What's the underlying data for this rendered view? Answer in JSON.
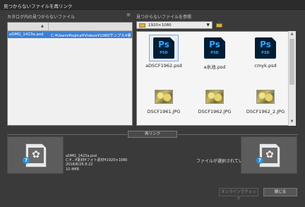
{
  "window": {
    "title": "見つからないファイルを再リンク"
  },
  "left": {
    "caption": "カタログ内の見つからないファイル",
    "menu_icon": "list-menu-icon",
    "columns": {
      "name": "ファイル名",
      "location": "元の場所"
    },
    "rows": [
      {
        "name": "aDMG_1423a.psd",
        "location": "C:¥Users¥tojma¥Videos¥1080サンプル¥素材¥..."
      }
    ]
  },
  "right": {
    "caption": "見つからないファイルを参照",
    "folder_value": "1920×1080",
    "tiles": [
      {
        "name": "aDSCF1962.psd",
        "kind": "psd",
        "selected": true
      },
      {
        "name": "a氷池.psd",
        "kind": "psd"
      },
      {
        "name": "cmyk.psd",
        "kind": "psd"
      },
      {
        "name": "DSCF1961.JPG",
        "kind": "jpg"
      },
      {
        "name": "DSCF1962.JPG",
        "kind": "jpg"
      },
      {
        "name": "DSCF1962_2.JPG",
        "kind": "jpg"
      }
    ],
    "psd_badge": "Ps",
    "psd_sub": "PSD"
  },
  "relink_label": "再リンク",
  "selected_info": {
    "lines": [
      "aDMG_1423a.psd",
      "C:¥...¥素材¥フォト素材¥1920×1080",
      "2018/6/26 8:22",
      "10.4MB"
    ]
  },
  "no_file_text": "ファイルが選択されていません",
  "buttons": {
    "online_check": "オンラインでチェック",
    "close": "閉じる"
  },
  "colors": {
    "selection": "#3e80d6",
    "ps_bg": "#001d34",
    "ps_fg": "#31a8ff",
    "badge": "#2d8fd6"
  }
}
